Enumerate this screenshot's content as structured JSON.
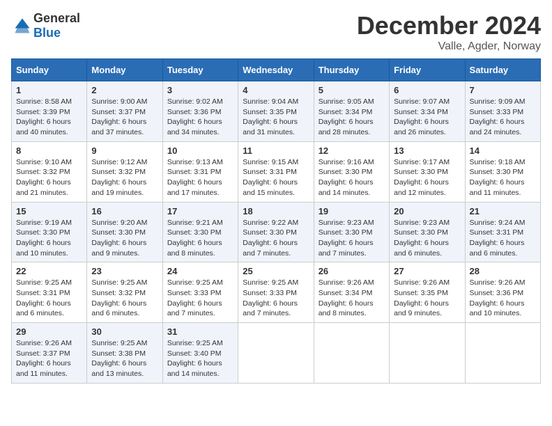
{
  "logo": {
    "text1": "General",
    "text2": "Blue"
  },
  "title": "December 2024",
  "subtitle": "Valle, Agder, Norway",
  "days_of_week": [
    "Sunday",
    "Monday",
    "Tuesday",
    "Wednesday",
    "Thursday",
    "Friday",
    "Saturday"
  ],
  "weeks": [
    [
      {
        "day": "1",
        "sunrise": "Sunrise: 8:58 AM",
        "sunset": "Sunset: 3:39 PM",
        "daylight": "Daylight: 6 hours and 40 minutes."
      },
      {
        "day": "2",
        "sunrise": "Sunrise: 9:00 AM",
        "sunset": "Sunset: 3:37 PM",
        "daylight": "Daylight: 6 hours and 37 minutes."
      },
      {
        "day": "3",
        "sunrise": "Sunrise: 9:02 AM",
        "sunset": "Sunset: 3:36 PM",
        "daylight": "Daylight: 6 hours and 34 minutes."
      },
      {
        "day": "4",
        "sunrise": "Sunrise: 9:04 AM",
        "sunset": "Sunset: 3:35 PM",
        "daylight": "Daylight: 6 hours and 31 minutes."
      },
      {
        "day": "5",
        "sunrise": "Sunrise: 9:05 AM",
        "sunset": "Sunset: 3:34 PM",
        "daylight": "Daylight: 6 hours and 28 minutes."
      },
      {
        "day": "6",
        "sunrise": "Sunrise: 9:07 AM",
        "sunset": "Sunset: 3:34 PM",
        "daylight": "Daylight: 6 hours and 26 minutes."
      },
      {
        "day": "7",
        "sunrise": "Sunrise: 9:09 AM",
        "sunset": "Sunset: 3:33 PM",
        "daylight": "Daylight: 6 hours and 24 minutes."
      }
    ],
    [
      {
        "day": "8",
        "sunrise": "Sunrise: 9:10 AM",
        "sunset": "Sunset: 3:32 PM",
        "daylight": "Daylight: 6 hours and 21 minutes."
      },
      {
        "day": "9",
        "sunrise": "Sunrise: 9:12 AM",
        "sunset": "Sunset: 3:32 PM",
        "daylight": "Daylight: 6 hours and 19 minutes."
      },
      {
        "day": "10",
        "sunrise": "Sunrise: 9:13 AM",
        "sunset": "Sunset: 3:31 PM",
        "daylight": "Daylight: 6 hours and 17 minutes."
      },
      {
        "day": "11",
        "sunrise": "Sunrise: 9:15 AM",
        "sunset": "Sunset: 3:31 PM",
        "daylight": "Daylight: 6 hours and 15 minutes."
      },
      {
        "day": "12",
        "sunrise": "Sunrise: 9:16 AM",
        "sunset": "Sunset: 3:30 PM",
        "daylight": "Daylight: 6 hours and 14 minutes."
      },
      {
        "day": "13",
        "sunrise": "Sunrise: 9:17 AM",
        "sunset": "Sunset: 3:30 PM",
        "daylight": "Daylight: 6 hours and 12 minutes."
      },
      {
        "day": "14",
        "sunrise": "Sunrise: 9:18 AM",
        "sunset": "Sunset: 3:30 PM",
        "daylight": "Daylight: 6 hours and 11 minutes."
      }
    ],
    [
      {
        "day": "15",
        "sunrise": "Sunrise: 9:19 AM",
        "sunset": "Sunset: 3:30 PM",
        "daylight": "Daylight: 6 hours and 10 minutes."
      },
      {
        "day": "16",
        "sunrise": "Sunrise: 9:20 AM",
        "sunset": "Sunset: 3:30 PM",
        "daylight": "Daylight: 6 hours and 9 minutes."
      },
      {
        "day": "17",
        "sunrise": "Sunrise: 9:21 AM",
        "sunset": "Sunset: 3:30 PM",
        "daylight": "Daylight: 6 hours and 8 minutes."
      },
      {
        "day": "18",
        "sunrise": "Sunrise: 9:22 AM",
        "sunset": "Sunset: 3:30 PM",
        "daylight": "Daylight: 6 hours and 7 minutes."
      },
      {
        "day": "19",
        "sunrise": "Sunrise: 9:23 AM",
        "sunset": "Sunset: 3:30 PM",
        "daylight": "Daylight: 6 hours and 7 minutes."
      },
      {
        "day": "20",
        "sunrise": "Sunrise: 9:23 AM",
        "sunset": "Sunset: 3:30 PM",
        "daylight": "Daylight: 6 hours and 6 minutes."
      },
      {
        "day": "21",
        "sunrise": "Sunrise: 9:24 AM",
        "sunset": "Sunset: 3:31 PM",
        "daylight": "Daylight: 6 hours and 6 minutes."
      }
    ],
    [
      {
        "day": "22",
        "sunrise": "Sunrise: 9:25 AM",
        "sunset": "Sunset: 3:31 PM",
        "daylight": "Daylight: 6 hours and 6 minutes."
      },
      {
        "day": "23",
        "sunrise": "Sunrise: 9:25 AM",
        "sunset": "Sunset: 3:32 PM",
        "daylight": "Daylight: 6 hours and 6 minutes."
      },
      {
        "day": "24",
        "sunrise": "Sunrise: 9:25 AM",
        "sunset": "Sunset: 3:33 PM",
        "daylight": "Daylight: 6 hours and 7 minutes."
      },
      {
        "day": "25",
        "sunrise": "Sunrise: 9:25 AM",
        "sunset": "Sunset: 3:33 PM",
        "daylight": "Daylight: 6 hours and 7 minutes."
      },
      {
        "day": "26",
        "sunrise": "Sunrise: 9:26 AM",
        "sunset": "Sunset: 3:34 PM",
        "daylight": "Daylight: 6 hours and 8 minutes."
      },
      {
        "day": "27",
        "sunrise": "Sunrise: 9:26 AM",
        "sunset": "Sunset: 3:35 PM",
        "daylight": "Daylight: 6 hours and 9 minutes."
      },
      {
        "day": "28",
        "sunrise": "Sunrise: 9:26 AM",
        "sunset": "Sunset: 3:36 PM",
        "daylight": "Daylight: 6 hours and 10 minutes."
      }
    ],
    [
      {
        "day": "29",
        "sunrise": "Sunrise: 9:26 AM",
        "sunset": "Sunset: 3:37 PM",
        "daylight": "Daylight: 6 hours and 11 minutes."
      },
      {
        "day": "30",
        "sunrise": "Sunrise: 9:25 AM",
        "sunset": "Sunset: 3:38 PM",
        "daylight": "Daylight: 6 hours and 13 minutes."
      },
      {
        "day": "31",
        "sunrise": "Sunrise: 9:25 AM",
        "sunset": "Sunset: 3:40 PM",
        "daylight": "Daylight: 6 hours and 14 minutes."
      },
      null,
      null,
      null,
      null
    ]
  ]
}
